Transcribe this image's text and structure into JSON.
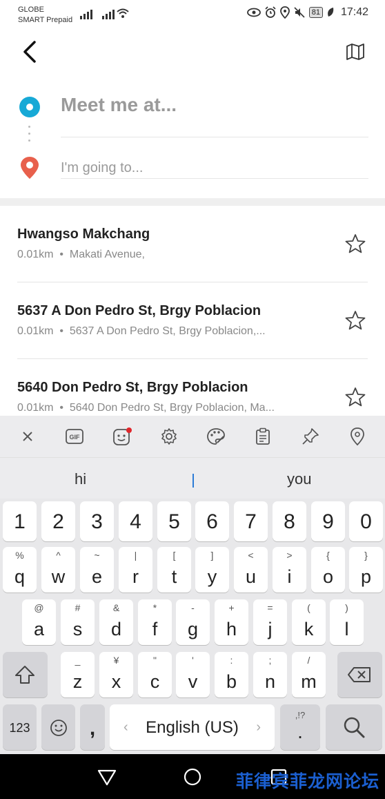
{
  "status_bar": {
    "carrier_line1": "GLOBE",
    "carrier_line2": "SMART Prepaid",
    "battery": "81",
    "time": "17:42"
  },
  "route": {
    "origin_placeholder": "Meet me at...",
    "destination_placeholder": "I'm going to..."
  },
  "results": [
    {
      "title": "Hwangso Makchang",
      "distance": "0.01km",
      "address": "Makati Avenue,"
    },
    {
      "title": "5637 A Don Pedro St, Brgy Poblacion",
      "distance": "0.01km",
      "address": "5637 A Don Pedro St, Brgy Poblacion,..."
    },
    {
      "title": "5640 Don Pedro St, Brgy Poblacion",
      "distance": "0.01km",
      "address": "5640 Don Pedro St, Brgy Poblacion, Ma..."
    }
  ],
  "separator_dot": "•",
  "keyboard": {
    "toolbar": [
      "close-icon",
      "gif-icon",
      "sticker-icon",
      "settings-icon",
      "theme-palette-icon",
      "clipboard-icon",
      "pin-icon",
      "location-icon"
    ],
    "gif_label": "GIF",
    "suggestions": [
      "hi",
      "you"
    ],
    "number_row": [
      "1",
      "2",
      "3",
      "4",
      "5",
      "6",
      "7",
      "8",
      "9",
      "0"
    ],
    "row1": [
      {
        "k": "q",
        "h": "%"
      },
      {
        "k": "w",
        "h": "^"
      },
      {
        "k": "e",
        "h": "~"
      },
      {
        "k": "r",
        "h": "|"
      },
      {
        "k": "t",
        "h": "["
      },
      {
        "k": "y",
        "h": "]"
      },
      {
        "k": "u",
        "h": "<"
      },
      {
        "k": "i",
        "h": ">"
      },
      {
        "k": "o",
        "h": "{"
      },
      {
        "k": "p",
        "h": "}"
      }
    ],
    "row2": [
      {
        "k": "a",
        "h": "@"
      },
      {
        "k": "s",
        "h": "#"
      },
      {
        "k": "d",
        "h": "&"
      },
      {
        "k": "f",
        "h": "*"
      },
      {
        "k": "g",
        "h": "-"
      },
      {
        "k": "h",
        "h": "+"
      },
      {
        "k": "j",
        "h": "="
      },
      {
        "k": "k",
        "h": "("
      },
      {
        "k": "l",
        "h": ")"
      }
    ],
    "row3": [
      {
        "k": "z",
        "h": "_"
      },
      {
        "k": "x",
        "h": "¥"
      },
      {
        "k": "c",
        "h": "\""
      },
      {
        "k": "v",
        "h": "'"
      },
      {
        "k": "b",
        "h": ":"
      },
      {
        "k": "n",
        "h": ";"
      },
      {
        "k": "m",
        "h": "/"
      }
    ],
    "symbols_label": "123",
    "comma": ",",
    "space_label": "English (US)",
    "period": ".",
    "period_hint": ",!?"
  },
  "watermark": "菲律宾菲龙网论坛",
  "colors": {
    "accent": "#17a9d6",
    "pin": "#e8604c"
  }
}
